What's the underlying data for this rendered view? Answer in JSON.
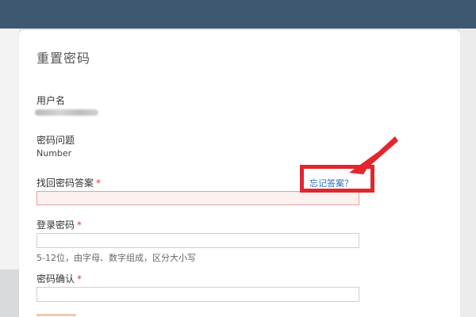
{
  "form": {
    "title": "重置密码",
    "username_label": "用户名",
    "question_label": "密码问题",
    "question_value": "Number",
    "answer_label": "找回密码答案",
    "required_mark": "*",
    "forgot_link": "忘记答案？",
    "password_label": "登录密码",
    "password_hint": "5-12位，由字母、数字组成，区分大小写",
    "confirm_label": "密码确认"
  },
  "colors": {
    "topbar": "#3f5872",
    "annotation_red": "#e2262e",
    "link_blue": "#2a6ebb",
    "error_border": "#e8a0a0"
  }
}
